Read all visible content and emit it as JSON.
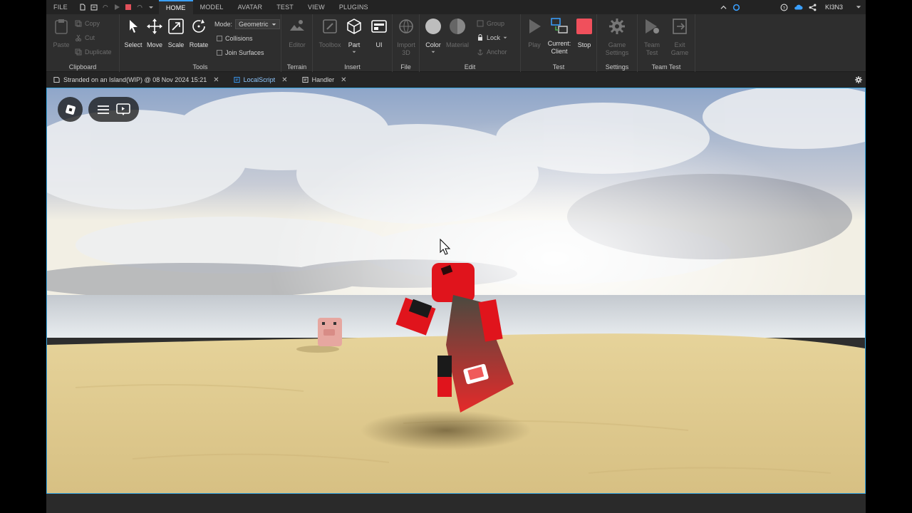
{
  "menu": {
    "items": [
      {
        "label": "FILE"
      },
      {
        "label": "HOME",
        "active": true
      },
      {
        "label": "MODEL"
      },
      {
        "label": "AVATAR"
      },
      {
        "label": "TEST"
      },
      {
        "label": "VIEW"
      },
      {
        "label": "PLUGINS"
      }
    ],
    "user": "KI3N3"
  },
  "ribbon": {
    "clipboard": {
      "label": "Clipboard",
      "paste": "Paste",
      "copy": "Copy",
      "cut": "Cut",
      "duplicate": "Duplicate"
    },
    "tools": {
      "label": "Tools",
      "select": "Select",
      "move": "Move",
      "scale": "Scale",
      "rotate": "Rotate",
      "mode_label": "Mode:",
      "mode_value": "Geometric",
      "collisions": "Collisions",
      "join_surfaces": "Join Surfaces"
    },
    "terrain": {
      "label": "Terrain",
      "editor": "Editor"
    },
    "insert": {
      "label": "Insert",
      "toolbox": "Toolbox",
      "part": "Part",
      "ui": "UI"
    },
    "file": {
      "label": "File",
      "import3d_line1": "Import",
      "import3d_line2": "3D"
    },
    "edit": {
      "label": "Edit",
      "color": "Color",
      "material": "Material",
      "group": "Group",
      "lock": "Lock",
      "anchor": "Anchor"
    },
    "test": {
      "label": "Test",
      "play": "Play",
      "current_line1": "Current:",
      "current_line2": "Client",
      "stop": "Stop"
    },
    "settings": {
      "label": "Settings",
      "game_line1": "Game",
      "game_line2": "Settings"
    },
    "team_test": {
      "label": "Team Test",
      "team_line1": "Team",
      "team_line2": "Test",
      "exit_line1": "Exit",
      "exit_line2": "Game"
    }
  },
  "tabs": [
    {
      "label": "Stranded on an Island(WIP) @ 08 Nov 2024 15:21"
    },
    {
      "label": "LocalScript"
    },
    {
      "label": "Handler"
    }
  ],
  "colors": {
    "accent": "#3aa0ff",
    "viewport_border": "#39a9e4",
    "stop": "#f0505c",
    "character": "#e0141c"
  }
}
